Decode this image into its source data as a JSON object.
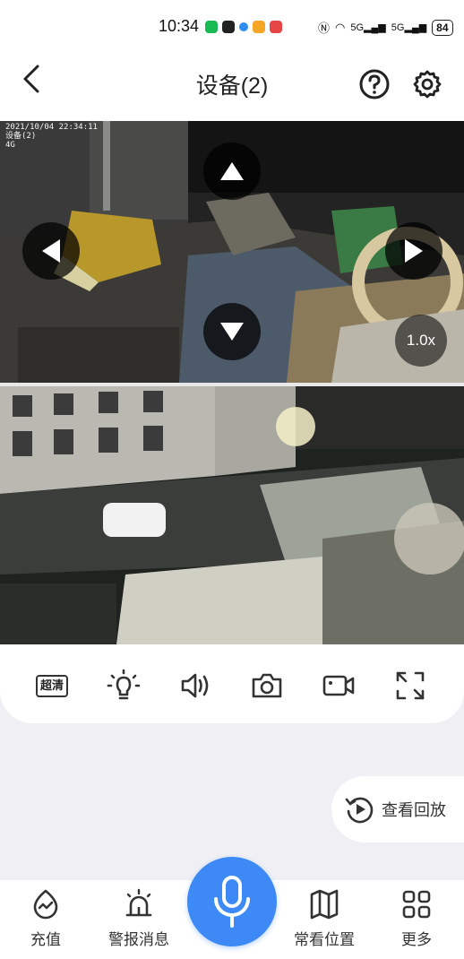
{
  "status_bar": {
    "time": "10:34",
    "signal_1": "5G",
    "signal_2": "5G",
    "battery": "84"
  },
  "header": {
    "title": "设备(2)",
    "back_icon": "chevron-left-icon",
    "help_icon": "question-circle-icon",
    "settings_icon": "gear-icon"
  },
  "video_top": {
    "osd_datetime": "2021/10/04 22:34:11",
    "osd_device": "设备(2)",
    "osd_network": "4G",
    "zoom_level": "1.0x",
    "ptz_controls": [
      "up-arrow-icon",
      "down-arrow-icon",
      "left-arrow-icon",
      "right-arrow-icon"
    ]
  },
  "controls": {
    "quality_label": "超清",
    "items": [
      "quality-button",
      "light-button",
      "sound-button",
      "snapshot-button",
      "record-button",
      "fullscreen-button"
    ]
  },
  "playback": {
    "label": "查看回放"
  },
  "bottom_nav": {
    "items": [
      {
        "label": "充值",
        "icon": "recharge-icon"
      },
      {
        "label": "警报消息",
        "icon": "alarm-icon"
      },
      {
        "label": "常看位置",
        "icon": "map-icon"
      },
      {
        "label": "更多",
        "icon": "grid-icon"
      }
    ],
    "mic_icon": "microphone-icon"
  },
  "colors": {
    "accent": "#3d8af7",
    "background": "#efeff4",
    "card": "#ffffff"
  }
}
